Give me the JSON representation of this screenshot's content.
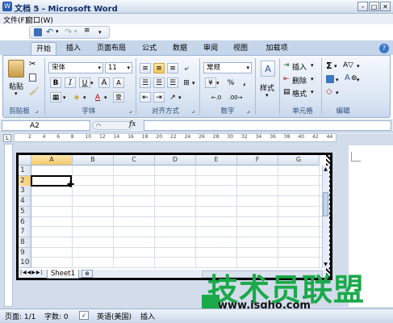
{
  "window": {
    "title": "文档 5 - Microsoft Word"
  },
  "menu": [
    "文件(F)",
    "窗口(W)"
  ],
  "tabs": [
    "开始",
    "插入",
    "页面布局",
    "公式",
    "数据",
    "审阅",
    "视图",
    "加载项"
  ],
  "clipboard": {
    "paste": "粘贴",
    "group": "剪贴板"
  },
  "font": {
    "name": "宋体",
    "size": "11",
    "bold": "B",
    "italic": "I",
    "underline": "U",
    "grow": "A",
    "shrink": "A",
    "color_letter": "A",
    "wen": "变",
    "group": "字体"
  },
  "alignment": {
    "group": "对齐方式"
  },
  "number": {
    "format": "常规",
    "group": "数字",
    "percent": "%",
    "comma": ",",
    "inc": ".00→.0",
    "dec": ".0→.00",
    "currency": "%"
  },
  "styles": {
    "label": "样式"
  },
  "cells": {
    "insert": "插入",
    "delete": "删除",
    "format": "格式",
    "group": "单元格"
  },
  "editing": {
    "sum": "Σ",
    "sort": "A▽",
    "find": "A",
    "group": "编辑"
  },
  "formula_bar": {
    "name_box": "A2",
    "fx": "fx"
  },
  "ruler_numbers": [
    "2",
    "4",
    "6",
    "8",
    "10",
    "12",
    "14",
    "16",
    "18",
    "20",
    "22",
    "24",
    "26",
    "28",
    "30",
    "32",
    "34",
    "36",
    "38",
    "40",
    "42",
    "44"
  ],
  "sheet": {
    "columns": [
      "A",
      "B",
      "C",
      "D",
      "E",
      "F",
      "G"
    ],
    "rows": [
      "1",
      "2",
      "3",
      "4",
      "5",
      "6",
      "7",
      "8",
      "9",
      "10"
    ],
    "active_cell": "A2",
    "tab_name": "Sheet1"
  },
  "status": {
    "page": "页面: 1/1",
    "words": "字数: 0",
    "language": "英语(美国)",
    "mode": "插入"
  },
  "watermark": {
    "text": "技术员联盟",
    "url": "www.jsgho.com"
  },
  "colors": {
    "accent": "#1aa94a",
    "ribbon": "#dbe6f3",
    "title": "#10306a"
  }
}
